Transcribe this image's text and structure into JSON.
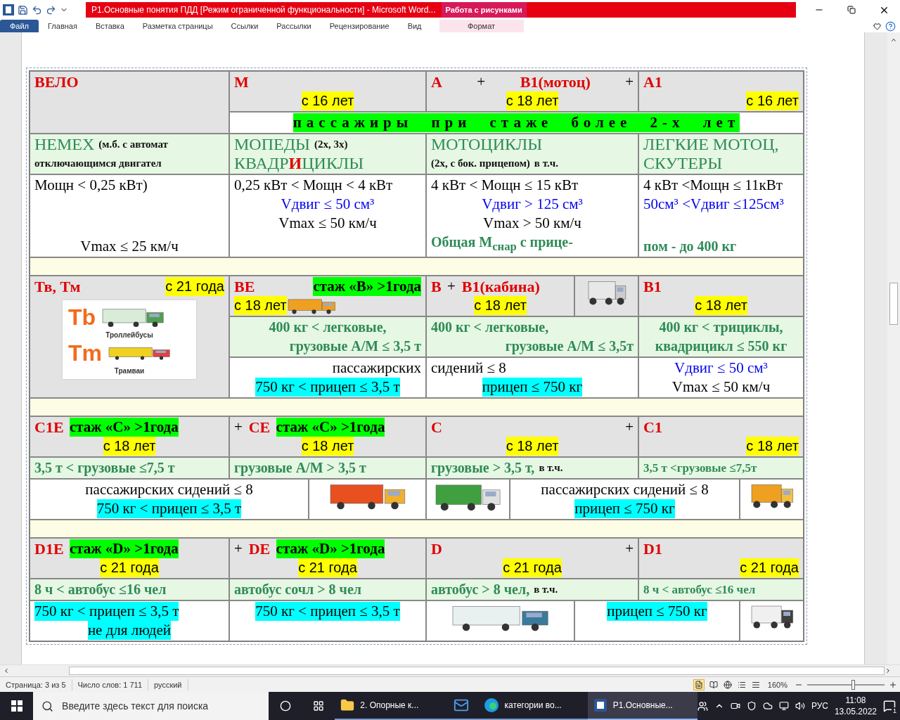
{
  "window": {
    "title": "Р1.Основные понятия ПДД [Режим ограниченной функциональности] - Microsoft Word...",
    "context_header": "Работа с рисунками"
  },
  "ribbon": {
    "tabs": [
      {
        "label": "Файл",
        "kind": "file"
      },
      {
        "label": "Главная",
        "kind": "standard"
      },
      {
        "label": "Вставка",
        "kind": "standard"
      },
      {
        "label": "Разметка страницы",
        "kind": "standard"
      },
      {
        "label": "Ссылки",
        "kind": "standard"
      },
      {
        "label": "Рассылки",
        "kind": "standard"
      },
      {
        "label": "Рецензирование",
        "kind": "standard"
      },
      {
        "label": "Вид",
        "kind": "standard"
      },
      {
        "label": "Формат",
        "kind": "context"
      }
    ]
  },
  "table": {
    "rows": [
      {
        "kind": "header",
        "cells": [
          {
            "lines": [
              [
                {
                  "kind": "category",
                  "text": "ВЕЛО"
                }
              ]
            ]
          },
          {
            "lines": [
              [
                {
                  "kind": "category",
                  "text": "М"
                }
              ],
              [
                {
                  "kind": "age",
                  "text": "с 16 лет"
                }
              ]
            ]
          },
          {
            "lines": [
              [
                {
                  "kind": "category",
                  "text": "А"
                },
                {
                  "kind": "spec",
                  "text": "+"
                },
                {
                  "kind": "category",
                  "text": "В1(мотоц)"
                },
                {
                  "kind": "spec",
                  "text": "+"
                }
              ],
              [
                {
                  "kind": "age",
                  "text": "с 18 лет"
                }
              ]
            ]
          },
          {
            "lines": [
              [
                {
                  "kind": "category",
                  "text": "А1"
                }
              ],
              [
                {
                  "kind": "age",
                  "text": "с 16 лет"
                }
              ]
            ]
          }
        ]
      },
      {
        "kind": "passengers",
        "cells": [
          {
            "lines": [
              [
                {
                  "kind": "passengers",
                  "text": "пассажиры при стаже более 2-х лет"
                }
              ]
            ]
          }
        ]
      },
      {
        "kind": "class",
        "cells": [
          {
            "lines": [
              [
                {
                  "kind": "class-name",
                  "text": "НЕМЕХ"
                },
                {
                  "kind": "note",
                  "text": "(м.б. с автомат"
                }
              ],
              [
                {
                  "kind": "note",
                  "text": "отключающимся двигател"
                }
              ]
            ]
          },
          {
            "lines": [
              [
                {
                  "kind": "class-name",
                  "text": "МОПЕДЫ"
                },
                {
                  "kind": "note",
                  "text": "(2х, 3х)"
                }
              ],
              [
                {
                  "kind": "class-name",
                  "text": "КВАДР"
                },
                {
                  "kind": "letter",
                  "text": "И"
                },
                {
                  "kind": "class-name",
                  "text": "ЦИКЛЫ"
                }
              ]
            ]
          },
          {
            "lines": [
              [
                {
                  "kind": "class-name",
                  "text": "МОТОЦИКЛЫ"
                }
              ],
              [
                {
                  "kind": "note",
                  "text": "(2х, с бок. прицепом)"
                },
                {
                  "kind": "note",
                  "text": "в т.ч."
                }
              ]
            ]
          },
          {
            "lines": [
              [
                {
                  "kind": "class-name",
                  "text": "ЛЕГКИЕ МОТОЦ,"
                }
              ],
              [
                {
                  "kind": "class-name",
                  "text": "СКУТЕРЫ"
                }
              ]
            ]
          }
        ]
      },
      {
        "kind": "specs",
        "cells": [
          {
            "lines": [
              [
                {
                  "kind": "spec",
                  "text": "Мощн < 0,25 кВт)"
                }
              ],
              [
                {
                  "kind": "spec",
                  "text": "Vmax ≤ 25 км/ч"
                }
              ]
            ]
          },
          {
            "lines": [
              [
                {
                  "kind": "spec",
                  "text": "0,25 кВт < Мощн < 4 кВт"
                }
              ],
              [
                {
                  "kind": "engine",
                  "text": "Vдвиг ≤ 50 см³"
                }
              ],
              [
                {
                  "kind": "spec",
                  "text": "Vmax ≤ 50 км/ч"
                }
              ]
            ]
          },
          {
            "lines": [
              [
                {
                  "kind": "spec",
                  "text": "4 кВт < Мощн ≤ 15 кВт"
                }
              ],
              [
                {
                  "kind": "engine",
                  "text": "Vдвиг > 125 см³"
                }
              ],
              [
                {
                  "kind": "spec",
                  "text": "Vmax > 50 км/ч"
                }
              ],
              [
                {
                  "kind": "class",
                  "text": "Общая М$_{снар}$ с прице-"
                }
              ]
            ]
          },
          {
            "lines": [
              [
                {
                  "kind": "spec",
                  "text": "4 кВт <Мощн ≤ 11кВт"
                }
              ],
              [
                {
                  "kind": "engine",
                  "text": "50см³ <Vдвиг ≤125см³"
                }
              ],
              [
                {
                  "kind": "class",
                  "text": "пом - до 400 кг"
                }
              ]
            ]
          }
        ]
      },
      {
        "kind": "band"
      },
      {
        "kind": "header-b",
        "cells": [
          {
            "lines": [
              [
                {
                  "kind": "category",
                  "text": "Тв, Тм"
                },
                {
                  "kind": "age",
                  "text": "с 21 года"
                }
              ]
            ],
            "sign": [
              {
                "mark": "Tb",
                "kind": "trolleybus",
                "caption": "Троллейбусы"
              },
              {
                "mark": "Tm",
                "kind": "tram",
                "caption": "Трамваи"
              }
            ]
          },
          {
            "lines": [
              [
                {
                  "kind": "category",
                  "text": "ВЕ"
                },
                {
                  "kind": "experience",
                  "text": "стаж «В» >1года"
                }
              ],
              [
                {
                  "kind": "age",
                  "text": "с 18 лет"
                },
                {
                  "kind": "pickup"
                }
              ]
            ]
          },
          {
            "lines": [
              [
                {
                  "kind": "category",
                  "text": "В"
                },
                {
                  "kind": "spec",
                  "text": "+"
                },
                {
                  "kind": "category",
                  "text": "В1(кабина)"
                }
              ],
              [
                {
                  "kind": "age",
                  "text": "с 18 лет"
                }
              ]
            ]
          },
          {
            "lines": [
              [
                {
                  "kind": "buggy"
                }
              ]
            ]
          },
          {
            "lines": [
              [
                {
                  "kind": "category",
                  "text": "В1"
                }
              ],
              [
                {
                  "kind": "age",
                  "text": "с 18 лет"
                }
              ]
            ]
          }
        ]
      },
      {
        "kind": "class-b",
        "cells": [
          {
            "lines": [
              [
                {
                  "kind": "class",
                  "text": "400 кг < легковые,"
                }
              ],
              [
                {
                  "kind": "class",
                  "text": "грузовые А/М ≤ 3,5 т"
                }
              ]
            ]
          },
          {
            "lines": [
              [
                {
                  "kind": "class",
                  "text": "400 кг < легковые,"
                }
              ],
              [
                {
                  "kind": "class",
                  "text": "грузовые А/М ≤ 3,5т"
                }
              ]
            ]
          },
          {
            "lines": [
              [
                {
                  "kind": "class",
                  "text": "400 кг < трициклы,"
                }
              ],
              [
                {
                  "kind": "class",
                  "text": "квадрицикл ≤ 550 кг"
                }
              ]
            ]
          }
        ]
      },
      {
        "kind": "specs-b",
        "cells": [
          {
            "lines": [
              [
                {
                  "kind": "spec",
                  "text": "пассажирских"
                }
              ],
              [
                {
                  "kind": "trailer",
                  "text": "750 кг < прицеп ≤ 3,5 т"
                }
              ]
            ]
          },
          {
            "lines": [
              [
                {
                  "kind": "spec",
                  "text": "сидений ≤ 8"
                }
              ],
              [
                {
                  "kind": "trailer",
                  "text": "прицеп ≤ 750 кг"
                }
              ]
            ]
          },
          {
            "lines": [
              [
                {
                  "kind": "engine",
                  "text": "Vдвиг ≤ 50 см³"
                }
              ],
              [
                {
                  "kind": "spec",
                  "text": "Vmax ≤ 50 км/ч"
                }
              ]
            ]
          }
        ]
      },
      {
        "kind": "band"
      },
      {
        "kind": "header",
        "cells": [
          {
            "lines": [
              [
                {
                  "kind": "category",
                  "text": "С1Е"
                },
                {
                  "kind": "experience",
                  "text": "стаж «С» >1года"
                }
              ],
              [
                {
                  "kind": "age",
                  "text": "с 18 лет"
                }
              ]
            ]
          },
          {
            "lines": [
              [
                {
                  "kind": "spec",
                  "text": "+"
                },
                {
                  "kind": "category",
                  "text": "СЕ"
                },
                {
                  "kind": "experience",
                  "text": "стаж «С» >1года"
                }
              ],
              [
                {
                  "kind": "age",
                  "text": "с 18 лет"
                }
              ]
            ]
          },
          {
            "lines": [
              [
                {
                  "kind": "category",
                  "text": "С"
                },
                {
                  "kind": "spec",
                  "text": "+"
                }
              ],
              [
                {
                  "kind": "age",
                  "text": "с 18 лет"
                }
              ]
            ]
          },
          {
            "lines": [
              [
                {
                  "kind": "category",
                  "text": "С1"
                }
              ],
              [
                {
                  "kind": "age",
                  "text": "с 18 лет"
                }
              ]
            ]
          }
        ]
      },
      {
        "kind": "class",
        "cells": [
          {
            "lines": [
              [
                {
                  "kind": "class",
                  "text": "3,5 т < грузовые ≤7,5 т"
                }
              ]
            ]
          },
          {
            "lines": [
              [
                {
                  "kind": "class",
                  "text": "грузовые А/М > 3,5 т"
                }
              ]
            ]
          },
          {
            "lines": [
              [
                {
                  "kind": "class",
                  "text": "грузовые > 3,5 т,"
                },
                {
                  "kind": "note",
                  "text": "в т.ч."
                }
              ]
            ]
          },
          {
            "lines": [
              [
                {
                  "kind": "class-small",
                  "text": "3,5 т <грузовые ≤7,5т"
                }
              ]
            ]
          }
        ]
      },
      {
        "kind": "vehicles-c",
        "cells": [
          {
            "lines": [
              [
                {
                  "kind": "spec",
                  "text": "пассажирских сидений ≤ 8"
                }
              ],
              [
                {
                  "kind": "trailer",
                  "text": "750 кг < прицеп ≤ 3,5 т"
                }
              ]
            ]
          },
          {
            "lines": [
              [
                {
                  "kind": "road-train"
                }
              ]
            ]
          },
          {
            "lines": [
              [
                {
                  "kind": "truck"
                }
              ]
            ]
          },
          {
            "lines": [
              [
                {
                  "kind": "spec",
                  "text": "пассажирских сидений ≤ 8"
                }
              ],
              [
                {
                  "kind": "trailer",
                  "text": "прицеп ≤ 750 кг"
                }
              ]
            ]
          },
          {
            "lines": [
              [
                {
                  "kind": "mixer"
                }
              ]
            ]
          }
        ]
      },
      {
        "kind": "band"
      },
      {
        "kind": "header",
        "cells": [
          {
            "lines": [
              [
                {
                  "kind": "category",
                  "text": "D1E"
                },
                {
                  "kind": "experience",
                  "text": "стаж «D» >1года"
                }
              ],
              [
                {
                  "kind": "age",
                  "text": "с 21 года"
                }
              ]
            ]
          },
          {
            "lines": [
              [
                {
                  "kind": "spec",
                  "text": "+"
                },
                {
                  "kind": "category",
                  "text": "DE"
                },
                {
                  "kind": "experience",
                  "text": "стаж «D» >1года"
                }
              ],
              [
                {
                  "kind": "age",
                  "text": "с 21 года"
                }
              ]
            ]
          },
          {
            "lines": [
              [
                {
                  "kind": "category",
                  "text": "D"
                },
                {
                  "kind": "spec",
                  "text": "+"
                }
              ],
              [
                {
                  "kind": "age",
                  "text": "с 21 года"
                }
              ]
            ]
          },
          {
            "lines": [
              [
                {
                  "kind": "category",
                  "text": "D1"
                }
              ],
              [
                {
                  "kind": "age",
                  "text": "с 21 года"
                }
              ]
            ]
          }
        ]
      },
      {
        "kind": "class",
        "cells": [
          {
            "lines": [
              [
                {
                  "kind": "class",
                  "text": "8 ч < автобус ≤16 чел"
                }
              ]
            ]
          },
          {
            "lines": [
              [
                {
                  "kind": "class",
                  "text": "автобус сочл > 8 чел"
                }
              ]
            ]
          },
          {
            "lines": [
              [
                {
                  "kind": "class",
                  "text": "автобус > 8 чел,"
                },
                {
                  "kind": "note",
                  "text": "в т.ч."
                }
              ]
            ]
          },
          {
            "lines": [
              [
                {
                  "kind": "class-small",
                  "text": "8 ч < автобус ≤16 чел"
                }
              ]
            ]
          }
        ]
      },
      {
        "kind": "vehicles-d",
        "cells": [
          {
            "lines": [
              [
                {
                  "kind": "trailer",
                  "text": "750 кг < прицеп ≤ 3,5 т"
                }
              ],
              [
                {
                  "kind": "trailer",
                  "text": "не для людей"
                }
              ]
            ]
          },
          {
            "lines": [
              [
                {
                  "kind": "trailer",
                  "text": "750 кг < прицеп ≤ 3,5 т"
                }
              ]
            ]
          },
          {
            "lines": [
              [
                {
                  "kind": "coach"
                }
              ]
            ]
          },
          {
            "lines": [
              [
                {
                  "kind": "trailer",
                  "text": "прицеп ≤ 750 кг"
                }
              ]
            ]
          },
          {
            "lines": [
              [
                {
                  "kind": "bus"
                }
              ]
            ]
          }
        ]
      }
    ]
  },
  "status_bar": {
    "page": "Страница: 3 из 5",
    "words": "Число слов: 1 711",
    "language": "русский",
    "zoom": "160%",
    "zoom_slider": {
      "level": 0.6
    }
  },
  "taskbar": {
    "search_placeholder": "Введите здесь текст для поиска",
    "apps": [
      {
        "kind": "folder",
        "label": "2. Опорные к...",
        "active": false
      },
      {
        "kind": "mail",
        "active": false
      },
      {
        "kind": "browser",
        "label": "категории во...",
        "active": false
      },
      {
        "kind": "word",
        "label": "Р1.Основные...",
        "active": true
      }
    ],
    "language": "РУС",
    "time": "11:08",
    "date": "13.05.2022",
    "notifications": "1"
  }
}
